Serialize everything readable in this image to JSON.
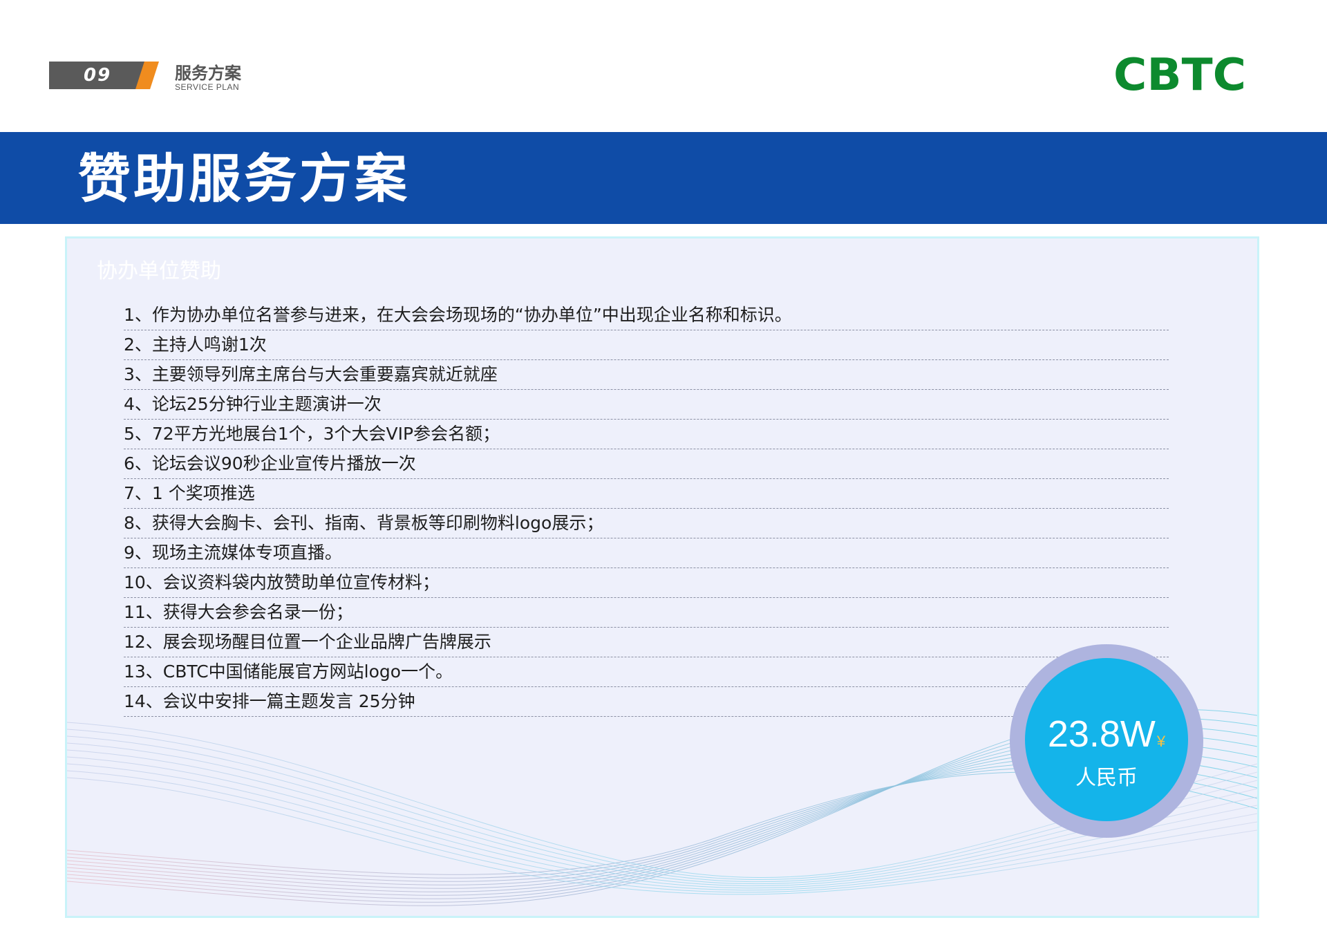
{
  "header": {
    "page_number": "09",
    "section_title": "服务方案",
    "section_subtitle": "SERVICE PLAN",
    "logo_text": "CBTC",
    "logo_color": "#0d8a2e"
  },
  "title_band": {
    "title": "赞助服务方案",
    "background_color": "#0f4ca7"
  },
  "panel": {
    "heading": "协办单位赞助",
    "items": [
      "1、作为协办单位名誉参与进来，在大会会场现场的“协办单位”中出现企业名称和标识。",
      "2、主持人鸣谢1次",
      "3、主要领导列席主席台与大会重要嘉宾就近就座",
      "4、论坛25分钟行业主题演讲一次",
      "5、72平方光地展台1个，3个大会VIP参会名额；",
      "6、论坛会议90秒企业宣传片播放一次",
      "7、1 个奖项推选",
      "8、获得大会胸卡、会刊、指南、背景板等印刷物料logo展示；",
      "9、现场主流媒体专项直播。",
      "10、会议资料袋内放赞助单位宣传材料；",
      "11、获得大会参会名录一份；",
      "12、展会现场醒目位置一个企业品牌广告牌展示",
      "13、CBTC中国储能展官方网站logo一个。",
      "14、会议中安排一篇主题发言 25分钟"
    ]
  },
  "price": {
    "amount": "23.8W",
    "currency_symbol": "¥",
    "currency_label": "人民币",
    "badge_color": "#14b4ea"
  }
}
